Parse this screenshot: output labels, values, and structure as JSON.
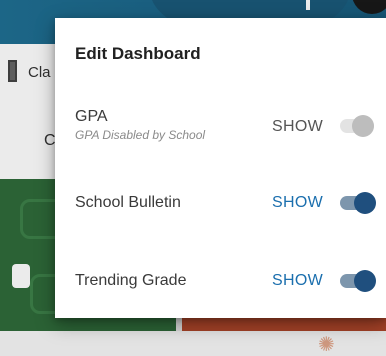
{
  "background": {
    "nav_label": "Cla",
    "nav_letter": "C",
    "colors": {
      "header": "#1f6f93",
      "tile_green": "#2f6b3a",
      "tile_red": "#b1472b"
    }
  },
  "dialog": {
    "title": "Edit Dashboard",
    "rows": [
      {
        "label": "GPA",
        "sublabel": "GPA Disabled by School",
        "action": "SHOW",
        "enabled": false
      },
      {
        "label": "School Bulletin",
        "action": "SHOW",
        "enabled": true
      },
      {
        "label": "Trending Grade",
        "action": "SHOW",
        "enabled": true
      }
    ]
  },
  "colors": {
    "accent_text": "#1b6fae",
    "toggle_on_knob": "#1f4f7e",
    "toggle_on_track": "#7d96ad",
    "toggle_off_knob": "#bdbdbd",
    "toggle_off_track": "#e3e3e3"
  },
  "icons": {
    "header_avatar": "avatar-icon",
    "nav": "class-icon",
    "tile": "tile-icon",
    "bottom": "decoration-icon"
  }
}
